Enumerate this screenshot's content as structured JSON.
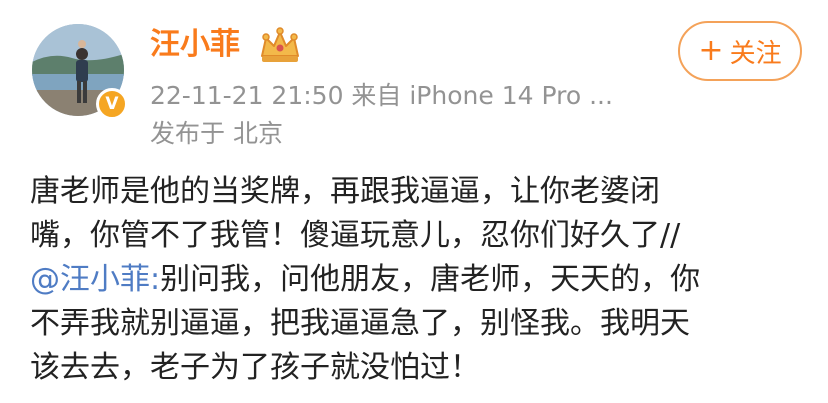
{
  "user": {
    "name": "汪小菲",
    "verified_mark": "V",
    "badge_icon": "crown-icon"
  },
  "post": {
    "meta": "22-11-21 21:50  来自 iPhone 14 Pro ...",
    "location": "发布于 北京",
    "lines": [
      "唐老师是他的当奖牌，再跟我逼逼，让你老婆闭",
      "嘴，你管不了我管！傻逼玩意儿，忍你们好久了//",
      "别问我，问他朋友，唐老师，天天的，你",
      "不弄我就别逼逼，把我逼逼急了，别怪我。我明天",
      "该去去，老子为了孩子就没怕过！"
    ],
    "mention": "@汪小菲:"
  },
  "follow": {
    "plus": "+",
    "label": "关注"
  },
  "colors": {
    "name": "#f97b1c",
    "meta": "#939393",
    "mention": "#4f7cc4",
    "follow_border": "#f4a259",
    "verified": "#f5a623"
  }
}
